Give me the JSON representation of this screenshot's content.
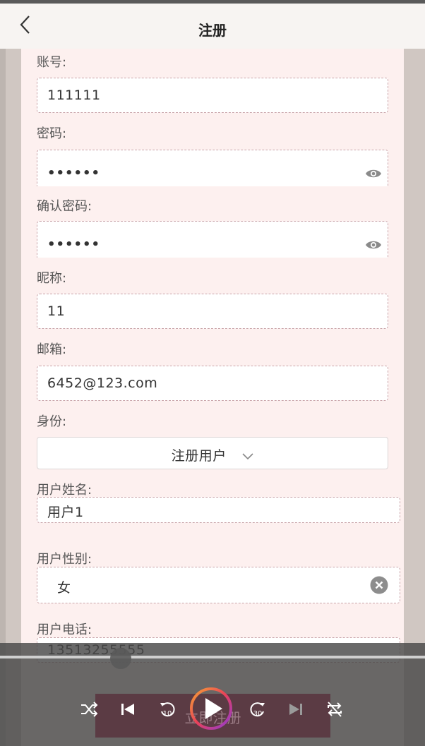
{
  "header": {
    "title": "注册"
  },
  "form": {
    "account_label": "账号:",
    "account_value": "111111",
    "password_label": "密码:",
    "password_value": "••••••",
    "confirm_label": "确认密码:",
    "confirm_value": "••••••",
    "nickname_label": "昵称:",
    "nickname_value": "11",
    "email_label": "邮箱:",
    "email_value": "6452@123.com",
    "identity_label": "身份:",
    "identity_value": "注册用户",
    "username_label": "用户姓名:",
    "username_value": "用户1",
    "gender_label": "用户性别:",
    "gender_value": "女",
    "phone_label": "用户电话:",
    "phone_value": "13513255555",
    "submit_label": "立即注册"
  },
  "player": {
    "controls": [
      "shuffle-icon",
      "skip-previous-icon",
      "replay-10-icon",
      "play-icon",
      "forward-30-icon",
      "skip-next-icon",
      "repeat-icon"
    ]
  }
}
